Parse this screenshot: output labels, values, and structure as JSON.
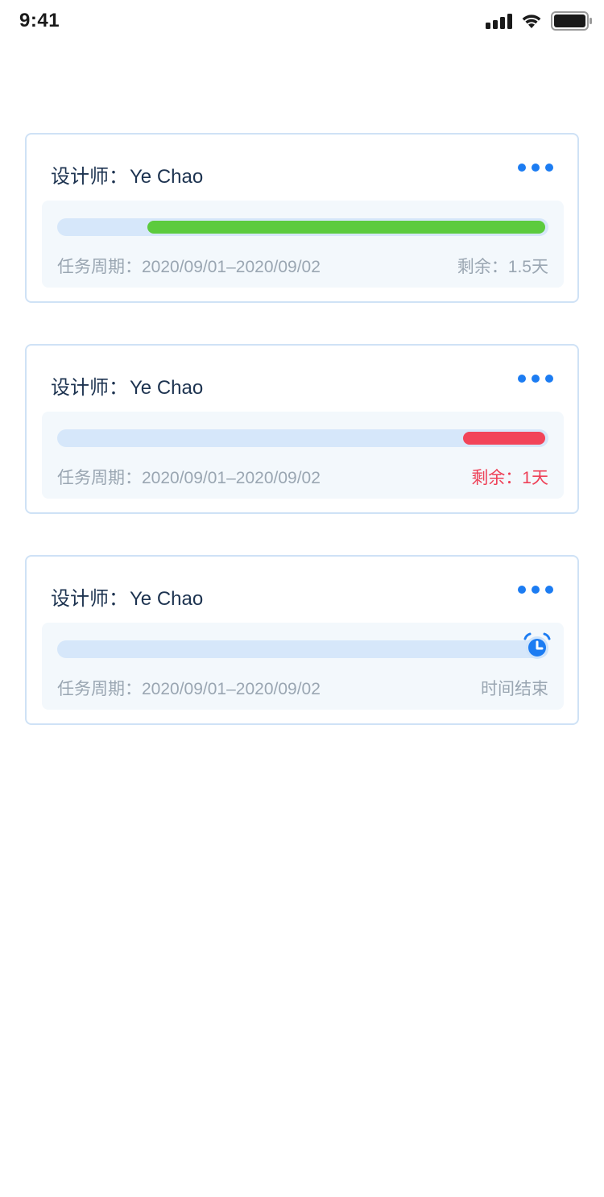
{
  "status_bar": {
    "time": "9:41"
  },
  "cards": [
    {
      "label": "设计师：",
      "designer": "Ye Chao",
      "period_label": "任务周期：",
      "period": "2020/09/01–2020/09/02",
      "remaining": "剩余：1.5天",
      "progress_remaining": 0.82,
      "bar_color": "#5ccb3e",
      "remaining_color": "#9aa6b2"
    },
    {
      "label": "设计师：",
      "designer": "Ye Chao",
      "period_label": "任务周期：",
      "period": "2020/09/01–2020/09/02",
      "remaining": "剩余：1天",
      "progress_remaining": 0.17,
      "bar_color": "#f24459",
      "remaining_color": "#ee4057"
    },
    {
      "label": "设计师：",
      "designer": "Ye Chao",
      "period_label": "任务周期：",
      "period": "2020/09/01–2020/09/02",
      "remaining": "时间结束",
      "progress_remaining": 0,
      "icon": "alarm-clock-icon",
      "remaining_color": "#9aa6b2"
    }
  ],
  "colors": {
    "accent": "#1c7cf2",
    "track": "#d6e7fa",
    "card_border": "#cfe2f6"
  }
}
